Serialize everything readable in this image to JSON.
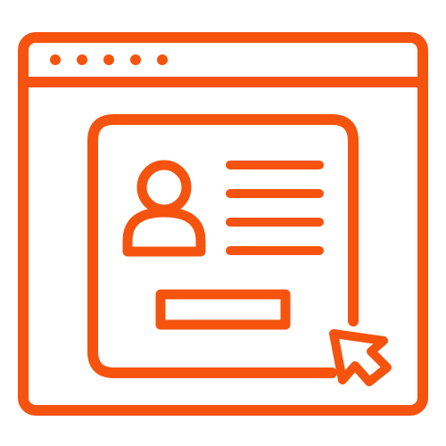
{
  "icon": {
    "name": "user-profile-web-page-icon",
    "style": "outline",
    "accent_color": "#f5530e",
    "background_color": "#ffffff",
    "window_control_dot_count": 5,
    "text_line_count": 4
  }
}
